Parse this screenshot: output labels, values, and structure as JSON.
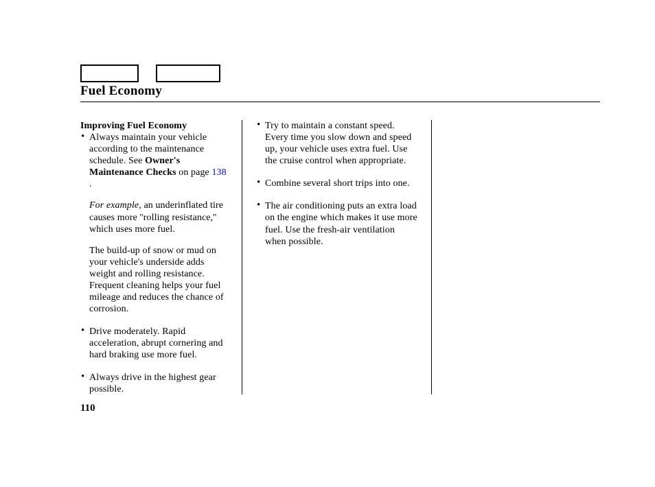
{
  "title": "Fuel Economy",
  "page_number": "110",
  "col1": {
    "subhead": "Improving Fuel Economy",
    "b1_pre": "Always maintain your vehicle according to the maintenance schedule. See ",
    "b1_bold": "Owner's Maintenance Checks",
    "b1_mid": " on page ",
    "b1_link": "138",
    "b1_post": " .",
    "b1_sub1_i": "For example,",
    "b1_sub1_rest": " an underinflated tire causes more ''rolling resistance,'' which uses more fuel.",
    "b1_sub2": "The build-up of snow or mud on your vehicle's underside adds weight and rolling resistance. Frequent cleaning helps your fuel mileage and reduces the chance of corrosion.",
    "b2": "Drive moderately. Rapid acceleration, abrupt cornering and hard braking use more fuel.",
    "b3": "Always drive in the highest gear possible."
  },
  "col2": {
    "b1": "Try to maintain a constant speed. Every time you slow down and speed up, your vehicle uses extra fuel. Use the cruise control when appropriate.",
    "b2": "Combine several short trips into one.",
    "b3": "The air conditioning puts an extra load on the engine which makes it use more fuel. Use the fresh-air ventilation when possible."
  }
}
